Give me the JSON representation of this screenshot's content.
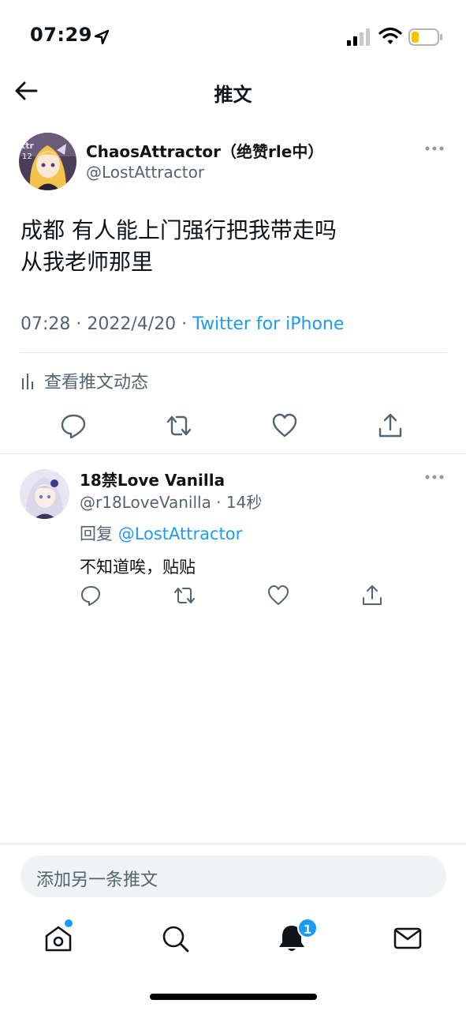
{
  "status_bar": {
    "time": "07:29"
  },
  "header": {
    "title": "推文"
  },
  "tweet": {
    "author_name": "ChaosAttractor（绝赞rle中）",
    "author_handle": "@LostAttractor",
    "text_line1": "成都 有人能上门强行把我带走吗",
    "text_line2": "从我老师那里",
    "timestamp": "07:28 · 2022/4/20 · ",
    "source": "Twitter for iPhone",
    "activity_label": "查看推文动态"
  },
  "reply": {
    "author_name": "18禁Love Vanilla",
    "author_handle": "@r18LoveVanilla · 14秒",
    "reply_to_label": "回复 ",
    "reply_to_mention": "@LostAttractor",
    "text": "不知道唉，贴贴"
  },
  "compose": {
    "placeholder": "添加另一条推文"
  },
  "tabbar": {
    "notification_count": "1"
  },
  "colors": {
    "accent": "#1d9bf0",
    "secondary_text": "#536471",
    "divider": "#e1e6ea"
  },
  "icons": [
    "location-arrow-icon",
    "signal-icon",
    "wifi-icon",
    "battery-icon",
    "back-arrow-icon",
    "more-icon",
    "activity-icon",
    "reply-icon",
    "retweet-icon",
    "like-icon",
    "share-icon",
    "home-icon",
    "search-icon",
    "notifications-icon",
    "messages-icon"
  ]
}
